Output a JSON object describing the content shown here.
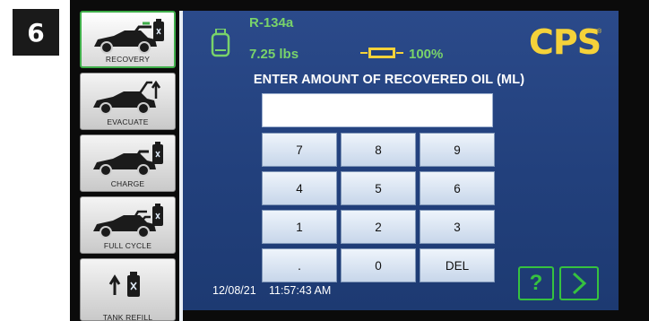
{
  "step": {
    "number": "6"
  },
  "sidebar": {
    "items": [
      {
        "label": "RECOVERY",
        "icon": "car-recovery-icon",
        "active": true
      },
      {
        "label": "EVACUATE",
        "icon": "car-evacuate-icon",
        "active": false
      },
      {
        "label": "CHARGE",
        "icon": "car-charge-icon",
        "active": false
      },
      {
        "label": "FULL CYCLE",
        "icon": "car-full-cycle-icon",
        "active": false
      },
      {
        "label": "TANK REFILL",
        "icon": "tank-refill-icon",
        "active": false
      }
    ]
  },
  "header": {
    "refrigerant": "R-134a",
    "weight": "7.25 lbs",
    "battery": "100%",
    "logo": "CPS",
    "logo_mark": "®"
  },
  "prompt": "ENTER AMOUNT OF RECOVERED OIL (ML)",
  "display": {
    "value": ""
  },
  "keypad": {
    "keys": [
      "7",
      "8",
      "9",
      "4",
      "5",
      "6",
      "1",
      "2",
      "3",
      ".",
      "0",
      "DEL"
    ]
  },
  "status": {
    "date": "12/08/21",
    "time": "11:57:43 AM"
  },
  "buttons": {
    "help": "?"
  },
  "colors": {
    "screen": "#22407c",
    "accent_green": "#79d36a",
    "button_green": "#36c23f",
    "logo_yellow": "#f5d23a",
    "key_fill": "#d9e4f2"
  }
}
